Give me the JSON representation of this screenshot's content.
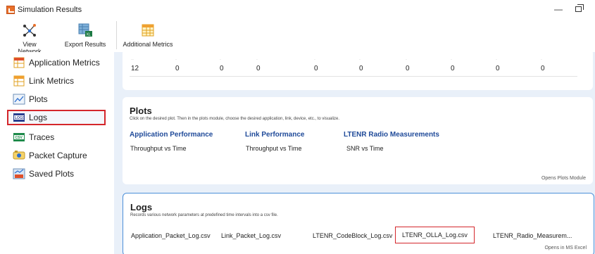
{
  "window": {
    "title": "Simulation Results"
  },
  "toolbar": {
    "view_network": "View Network",
    "export_results": "Export Results",
    "additional_metrics": "Additional Metrics"
  },
  "sidebar": {
    "items": [
      {
        "label": "Application Metrics",
        "icon": "spreadsheet-icon"
      },
      {
        "label": "Link Metrics",
        "icon": "spreadsheet-icon"
      },
      {
        "label": "Plots",
        "icon": "chart-icon"
      },
      {
        "label": "Logs",
        "icon": "logs-icon",
        "active": true
      },
      {
        "label": "Traces",
        "icon": "csv-icon"
      },
      {
        "label": "Packet Capture",
        "icon": "packet-capture-icon"
      },
      {
        "label": "Saved Plots",
        "icon": "saved-plots-icon"
      }
    ]
  },
  "table": {
    "row": [
      "12",
      "0",
      "0",
      "0",
      "0",
      "0",
      "0",
      "0",
      "0",
      "0"
    ]
  },
  "plots": {
    "title": "Plots",
    "description": "Click on the desired plot. Then in the plots module, choose the desired application, link, device, etc., to visualize.",
    "columns": [
      {
        "heading": "Application Performance",
        "item": "Throughput vs Time"
      },
      {
        "heading": "Link Performance",
        "item": "Throughput vs Time"
      },
      {
        "heading": "LTENR Radio Measurements",
        "item": "SNR vs Time"
      }
    ],
    "footer": "Opens Plots Module"
  },
  "logs": {
    "title": "Logs",
    "description": "Records various network parameters at predefined time intervals into a csv file.",
    "files": [
      "Application_Packet_Log.csv",
      "Link_Packet_Log.csv",
      "LTENR_CodeBlock_Log.csv",
      "LTENR_OLLA_Log.csv",
      "LTENR_Radio_Measurem..."
    ],
    "footer": "Opens in MS Excel"
  },
  "colors": {
    "accent_blue": "#1f4a99",
    "highlight_red": "#d4262b",
    "panel_bg": "#e9f0f9",
    "card_border": "#4b8fd8"
  }
}
